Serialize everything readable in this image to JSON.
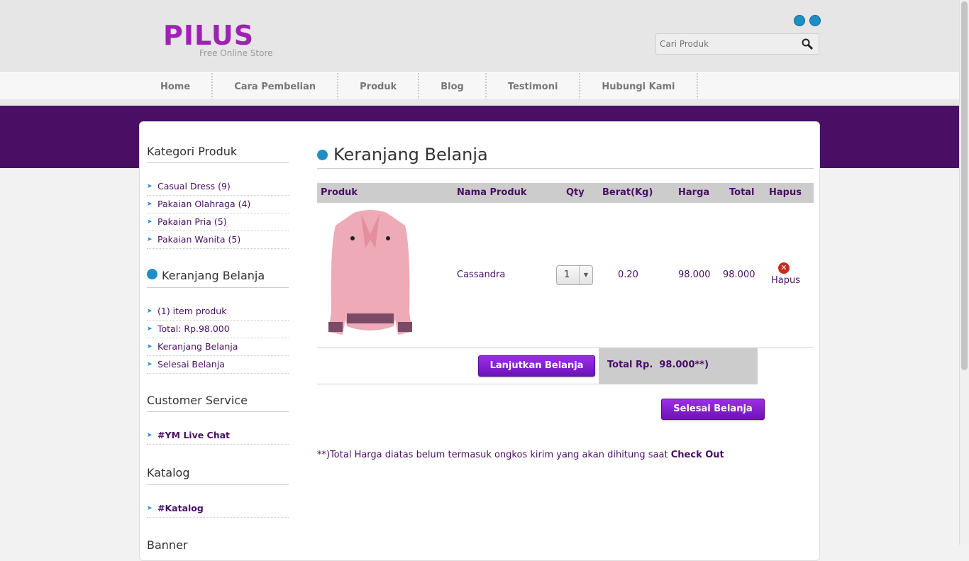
{
  "header": {
    "logo_text": "PILUS",
    "logo_tagline": "Free Online Store",
    "search_placeholder": "Cari Produk"
  },
  "nav": {
    "items": [
      "Home",
      "Cara Pembelian",
      "Produk",
      "Blog",
      "Testimoni",
      "Hubungi Kami"
    ]
  },
  "sidebar": {
    "kategori_title": "Kategori Produk",
    "kategori_items": [
      "Casual Dress (9)",
      "Pakaian Olahraga (4)",
      "Pakaian Pria (5)",
      "Pakaian Wanita (5)"
    ],
    "keranjang_title": "Keranjang Belanja",
    "keranjang_items": [
      "(1) item produk",
      "Total: Rp.98.000",
      "Keranjang Belanja",
      "Selesai Belanja"
    ],
    "cs_title": "Customer Service",
    "cs_items": [
      "#YM Live Chat"
    ],
    "katalog_title": "Katalog",
    "katalog_items": [
      "#Katalog"
    ],
    "banner_title": "Banner"
  },
  "cart": {
    "title": "Keranjang Belanja",
    "columns": [
      "Produk",
      "Nama Produk",
      "Qty",
      "Berat(Kg)",
      "Harga",
      "Total",
      "Hapus"
    ],
    "items": [
      {
        "name": "Cassandra",
        "qty": "1",
        "berat": "0.20",
        "harga": "98.000",
        "total": "98.000",
        "hapus": "Hapus"
      }
    ],
    "continue_button": "Lanjutkan Belanja",
    "total_label": "Total Rp.  98.000**)",
    "finish_button": "Selesai Belanja",
    "note_text": "**)Total Harga diatas belum termasuk ongkos kirim yang akan dihitung saat ",
    "note_bold": "Check Out"
  },
  "colors": {
    "brand": "#a021b5",
    "band": "#4a0f64",
    "link": "#4a0f64",
    "button": "#7e1fcc"
  }
}
